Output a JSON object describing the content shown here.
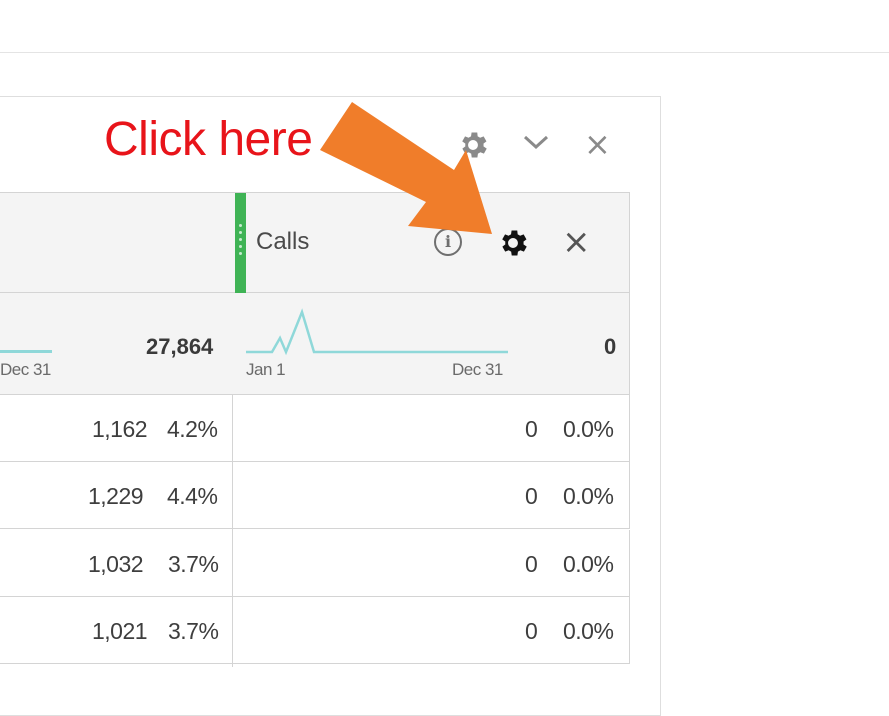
{
  "annotation": {
    "text": "Click here",
    "color": "#e8141a",
    "arrow_color": "#f07d2a"
  },
  "panel": {
    "toolbar_icons": [
      "gear-icon",
      "chevron-down-icon",
      "close-icon"
    ],
    "close_glyph": "×",
    "chevron_glyph": "⌄"
  },
  "column": {
    "title": "Calls",
    "info_glyph": "i",
    "close_glyph": "×",
    "accent_color": "#3fb355"
  },
  "summary": {
    "left_total": "27,864",
    "right_total": "0",
    "left_spark_end_label": "Dec 31",
    "spark_start_label": "Jan 1",
    "spark_end_label": "Dec 31",
    "sparkline_color": "#8fd8d9"
  },
  "rows": [
    {
      "left_value": "1,162",
      "left_pct": "4.2%",
      "right_value": "0",
      "right_pct": "0.0%"
    },
    {
      "left_value": "1,229",
      "left_pct": "4.4%",
      "right_value": "0",
      "right_pct": "0.0%"
    },
    {
      "left_value": "1,032",
      "left_pct": "3.7%",
      "right_value": "0",
      "right_pct": "0.0%"
    },
    {
      "left_value": "1,021",
      "left_pct": "3.7%",
      "right_value": "0",
      "right_pct": "0.0%"
    }
  ]
}
